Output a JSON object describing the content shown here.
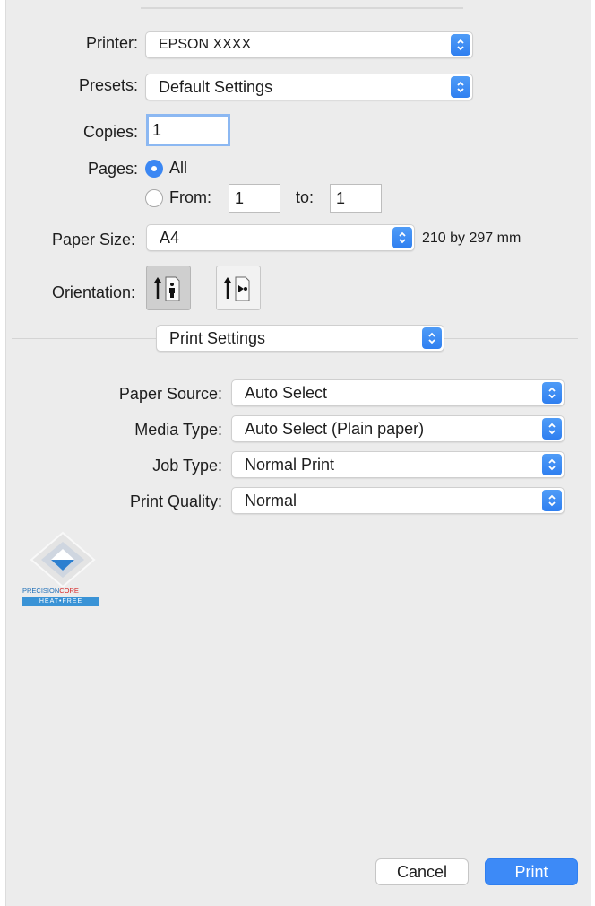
{
  "printer": {
    "label": "Printer:",
    "value": "EPSON XXXX"
  },
  "presets": {
    "label": "Presets:",
    "value": "Default Settings"
  },
  "copies": {
    "label": "Copies:",
    "value": "1"
  },
  "pages": {
    "label": "Pages:",
    "all_label": "All",
    "from_label": "From:",
    "from_value": "1",
    "to_label": "to:",
    "to_value": "1",
    "selected": "All"
  },
  "paper_size": {
    "label": "Paper Size:",
    "value": "A4",
    "dimensions": "210 by 297 mm"
  },
  "orientation": {
    "label": "Orientation:",
    "selected": "portrait"
  },
  "section": {
    "value": "Print Settings"
  },
  "paper_source": {
    "label": "Paper Source:",
    "value": "Auto Select"
  },
  "media_type": {
    "label": "Media Type:",
    "value": "Auto Select (Plain paper)"
  },
  "job_type": {
    "label": "Job Type:",
    "value": "Normal Print"
  },
  "print_quality": {
    "label": "Print Quality:",
    "value": "Normal"
  },
  "logo": {
    "text_a": "PRECISION",
    "text_b": "CORE",
    "badge": "HEAT•FREE"
  },
  "buttons": {
    "cancel": "Cancel",
    "print": "Print"
  },
  "colors": {
    "accent": "#3d8af7",
    "background": "#ececec"
  }
}
